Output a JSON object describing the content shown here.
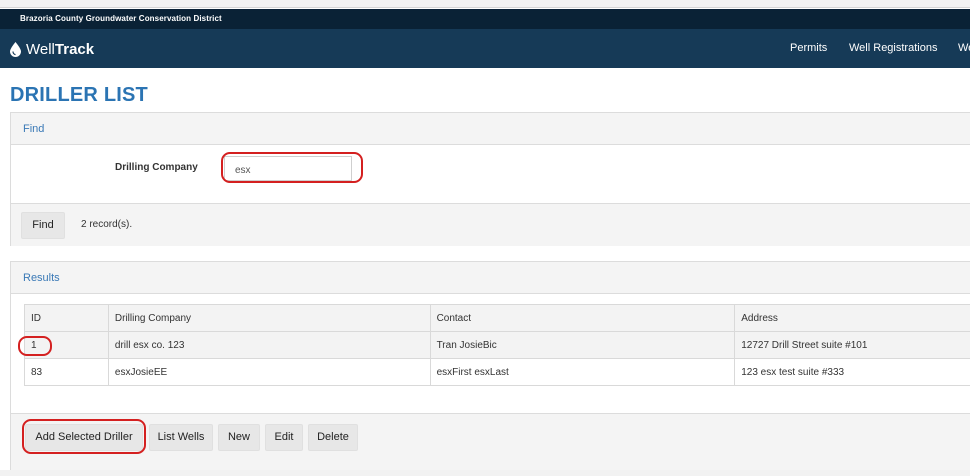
{
  "org": {
    "name": "Brazoria County Groundwater Conservation District"
  },
  "brand": {
    "part1": "Well",
    "part2": "Track",
    "icon": "water-drop-icon"
  },
  "nav": {
    "items": [
      "Permits",
      "Well Registrations",
      "We"
    ]
  },
  "page": {
    "title": "DRILLER LIST"
  },
  "find": {
    "title": "Find",
    "field_label": "Drilling Company",
    "field_value": "esx",
    "button": "Find",
    "record_count": "2 record(s)."
  },
  "results": {
    "title": "Results",
    "columns": [
      "ID",
      "Drilling Company",
      "Contact",
      "Address"
    ],
    "rows": [
      [
        "1",
        "drill esx co. 123",
        "Tran JosieBic",
        "12727 Drill Street suite #101"
      ],
      [
        "83",
        "esxJosieEE",
        "esxFirst esxLast",
        "123 esx test suite #333"
      ]
    ],
    "buttons": [
      "Add Selected Driller",
      "List Wells",
      "New",
      "Edit",
      "Delete"
    ]
  },
  "colors": {
    "nav_bg": "#163a57",
    "org_bg": "#0a2236",
    "title_blue": "#2b74b3",
    "annotation_red": "#d42020"
  }
}
